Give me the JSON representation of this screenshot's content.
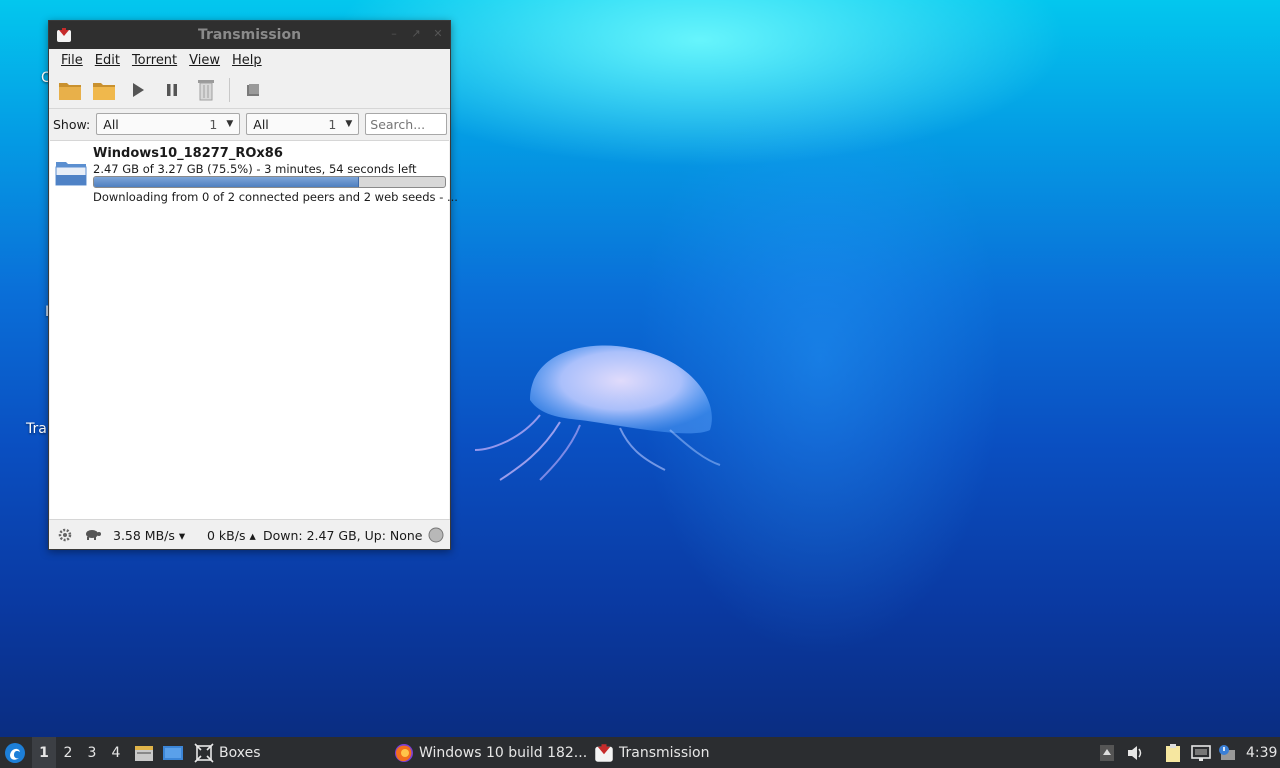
{
  "window": {
    "title": "Transmission",
    "menu": [
      "File",
      "Edit",
      "Torrent",
      "View",
      "Help"
    ],
    "filter": {
      "show_label": "Show:",
      "category": {
        "value": "All",
        "count": "1"
      },
      "tracker": {
        "value": "All",
        "count": "1"
      },
      "search_placeholder": "Search..."
    },
    "torrents": [
      {
        "name": "Windows10_18277_ROx86",
        "progress_text": "2.47 GB of 3.27 GB (75.5%) - 3 minutes, 54 seconds left",
        "progress": 0.755,
        "status": "Downloading from 0 of 2 connected peers and 2 web seeds - ..."
      }
    ],
    "statusbar": {
      "down_rate": "3.58 MB/s ▾",
      "up_rate": "0 kB/s ▴",
      "totals": "Down: 2.47 GB, Up: None"
    }
  },
  "desktop_labels": [
    "C",
    "I",
    "Tra"
  ],
  "taskbar": {
    "workspaces": [
      "1",
      "2",
      "3",
      "4"
    ],
    "boxes_label": "Boxes",
    "tasks": [
      {
        "label": "Windows 10 build 182...",
        "icon": "firefox-icon"
      },
      {
        "label": "Transmission",
        "icon": "transmission-icon"
      }
    ],
    "clock": "4:39"
  },
  "colors": {
    "accent": "#4f7fbf",
    "taskbar": "#2b2d30",
    "titlebar": "#2f2f2f"
  }
}
